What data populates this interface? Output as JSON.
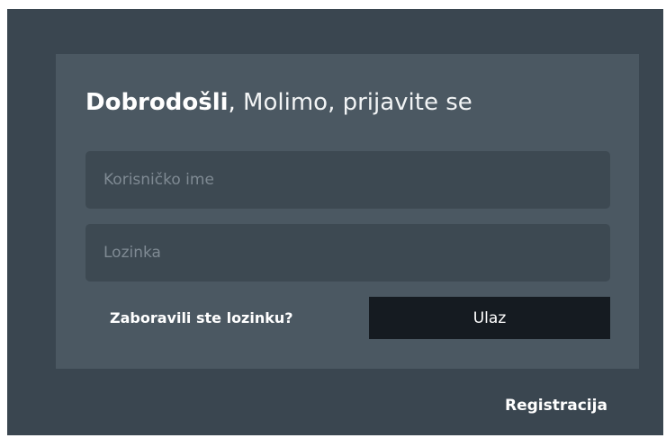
{
  "login": {
    "title_bold": "Dobrodošli",
    "title_comma": ",",
    "title_rest": " Molimo, prijavite se",
    "username_placeholder": "Korisničko ime",
    "password_placeholder": "Lozinka",
    "forgot_label": "Zaboravili ste lozinku?",
    "submit_label": "Ulaz"
  },
  "footer": {
    "register_label": "Registracija"
  },
  "colors": {
    "background": "#3a4650",
    "panel": "#4b5862",
    "input": "#3d4952",
    "button": "#151b21",
    "text": "#ffffff"
  }
}
